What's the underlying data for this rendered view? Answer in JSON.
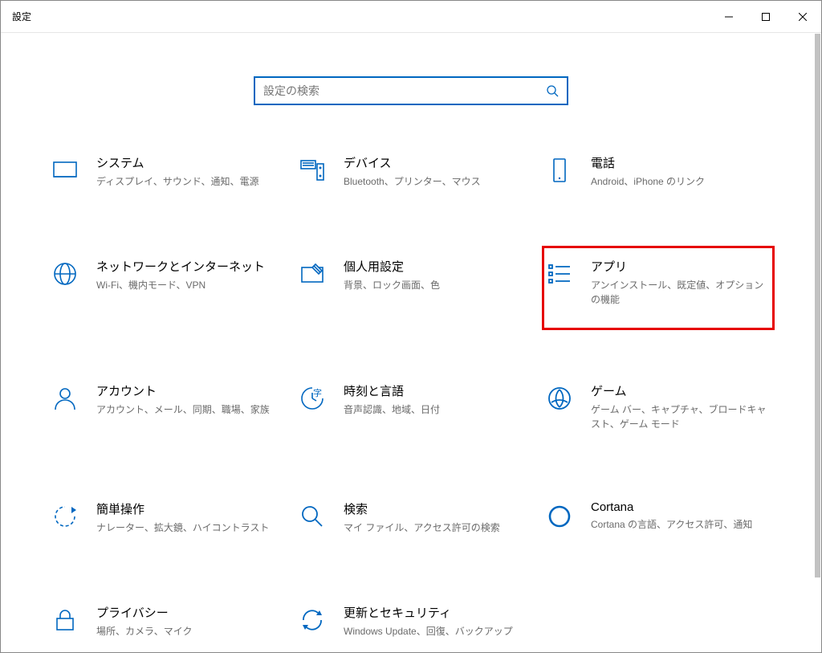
{
  "window": {
    "title": "設定"
  },
  "search": {
    "placeholder": "設定の検索"
  },
  "tiles": [
    {
      "id": "system",
      "title": "システム",
      "desc": "ディスプレイ、サウンド、通知、電源"
    },
    {
      "id": "devices",
      "title": "デバイス",
      "desc": "Bluetooth、プリンター、マウス"
    },
    {
      "id": "phone",
      "title": "電話",
      "desc": "Android、iPhone のリンク"
    },
    {
      "id": "network",
      "title": "ネットワークとインターネット",
      "desc": "Wi-Fi、機内モード、VPN"
    },
    {
      "id": "personalize",
      "title": "個人用設定",
      "desc": "背景、ロック画面、色"
    },
    {
      "id": "apps",
      "title": "アプリ",
      "desc": "アンインストール、既定値、オプションの機能",
      "highlight": true
    },
    {
      "id": "accounts",
      "title": "アカウント",
      "desc": "アカウント、メール、同期、職場、家族"
    },
    {
      "id": "time",
      "title": "時刻と言語",
      "desc": "音声認識、地域、日付"
    },
    {
      "id": "gaming",
      "title": "ゲーム",
      "desc": "ゲーム バー、キャプチャ、ブロードキャスト、ゲーム モード"
    },
    {
      "id": "ease",
      "title": "簡単操作",
      "desc": "ナレーター、拡大鏡、ハイコントラスト"
    },
    {
      "id": "searchcat",
      "title": "検索",
      "desc": "マイ ファイル、アクセス許可の検索"
    },
    {
      "id": "cortana",
      "title": "Cortana",
      "desc": "Cortana の言語、アクセス許可、通知"
    },
    {
      "id": "privacy",
      "title": "プライバシー",
      "desc": "場所、カメラ、マイク"
    },
    {
      "id": "update",
      "title": "更新とセキュリティ",
      "desc": "Windows Update、回復、バックアップ"
    }
  ]
}
